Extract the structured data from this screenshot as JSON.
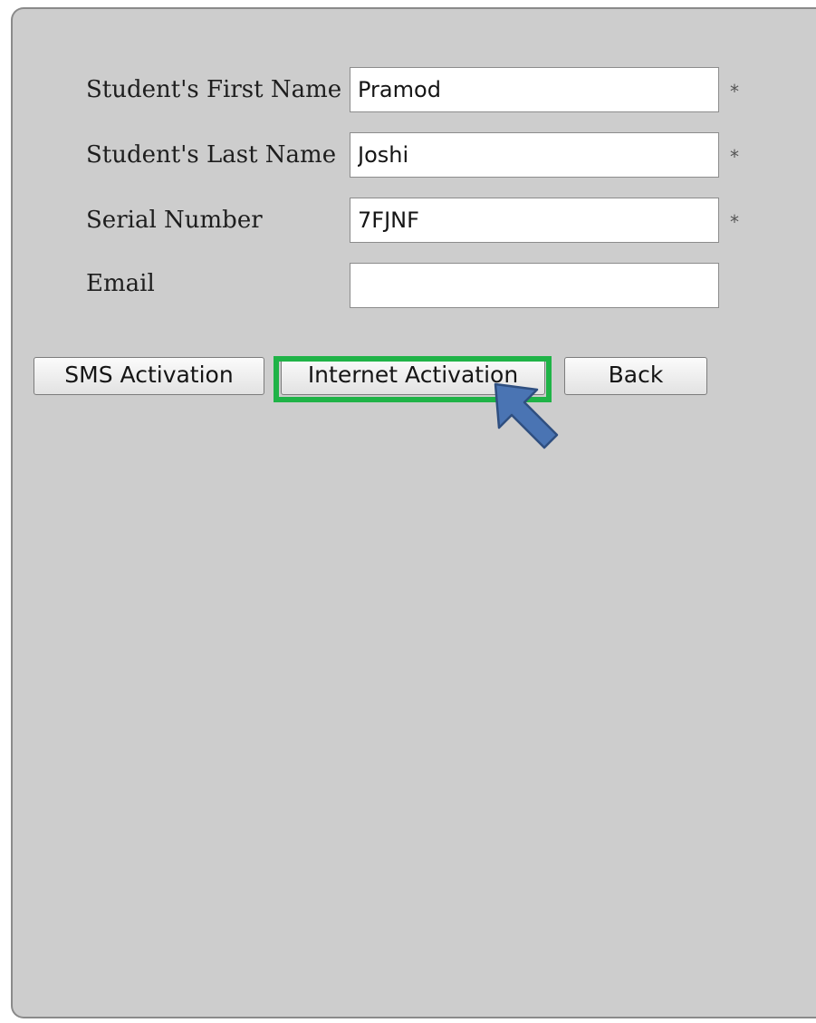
{
  "form": {
    "first_name": {
      "label": "Student's First Name",
      "value": "Pramod",
      "required_mark": "*"
    },
    "last_name": {
      "label": "Student's Last Name",
      "value": "Joshi",
      "required_mark": "*"
    },
    "serial": {
      "label": "Serial Number",
      "value": "7FJNF",
      "required_mark": "*"
    },
    "email": {
      "label": "Email",
      "value": ""
    }
  },
  "buttons": {
    "sms": "SMS Activation",
    "internet": "Internet Activation",
    "back": "Back"
  },
  "colors": {
    "highlight": "#1fb347",
    "arrow_fill": "#4a74b3",
    "panel_bg": "#cdcdcd"
  },
  "icons": {
    "pointer_arrow": "arrow-up-left-icon"
  }
}
